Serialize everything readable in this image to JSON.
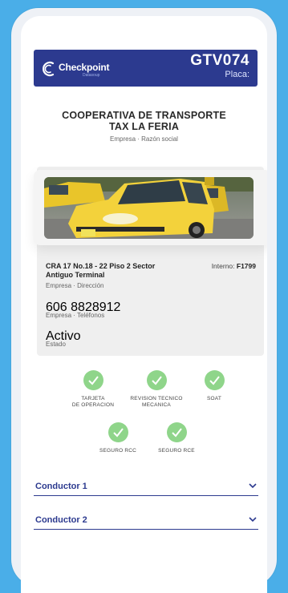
{
  "header": {
    "logo_name": "Checkpoint",
    "logo_sub": "Datasoup",
    "plate": "GTV074",
    "plate_label": "Placa:"
  },
  "company": {
    "name_line1": "COOPERATIVA DE TRANSPORTE",
    "name_line2": "TAX LA FERIA",
    "caption": "Empresa · Razón social"
  },
  "details": {
    "address": "CRA 17 No.18 - 22 Piso 2 Sector Antiguo Terminal",
    "address_caption": "Empresa · Dirección",
    "interno_label": "Interno:",
    "interno_value": "F1799",
    "phone": "606 8828912",
    "phone_caption": "Empresa · Teléfonos",
    "status": "Activo",
    "status_caption": "Estado"
  },
  "documents": [
    {
      "label_line1": "TARJETA",
      "label_line2": "DE OPERACION"
    },
    {
      "label_line1": "REVISION TECNICO",
      "label_line2": "MECANICA"
    },
    {
      "label_line1": "SOAT",
      "label_line2": ""
    },
    {
      "label_line1": "SEGURO RCC",
      "label_line2": ""
    },
    {
      "label_line1": "SEGURO RCE",
      "label_line2": ""
    }
  ],
  "accordions": [
    {
      "label": "Conductor 1"
    },
    {
      "label": "Conductor 2"
    }
  ],
  "colors": {
    "background": "#4aaee8",
    "brand": "#2c3a8f",
    "check": "#8fd58a"
  }
}
